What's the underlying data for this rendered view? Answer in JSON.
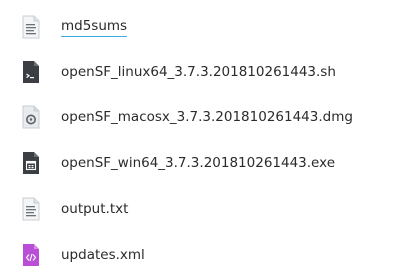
{
  "files": [
    {
      "name": "md5sums",
      "icon": "text-document-icon",
      "focused": true
    },
    {
      "name": "openSF_linux64_3.7.3.201810261443.sh",
      "icon": "shell-script-icon",
      "focused": false
    },
    {
      "name": "openSF_macosx_3.7.3.201810261443.dmg",
      "icon": "disk-image-icon",
      "focused": false
    },
    {
      "name": "openSF_win64_3.7.3.201810261443.exe",
      "icon": "executable-icon",
      "focused": false
    },
    {
      "name": "output.txt",
      "icon": "text-document-icon",
      "focused": false
    },
    {
      "name": "updates.xml",
      "icon": "xml-document-icon",
      "focused": false
    }
  ],
  "colors": {
    "focus_underline": "#3daee9",
    "text": "#2b2b2b",
    "xml_icon": "#b84fd6",
    "dark_icon": "#3b3f44"
  }
}
